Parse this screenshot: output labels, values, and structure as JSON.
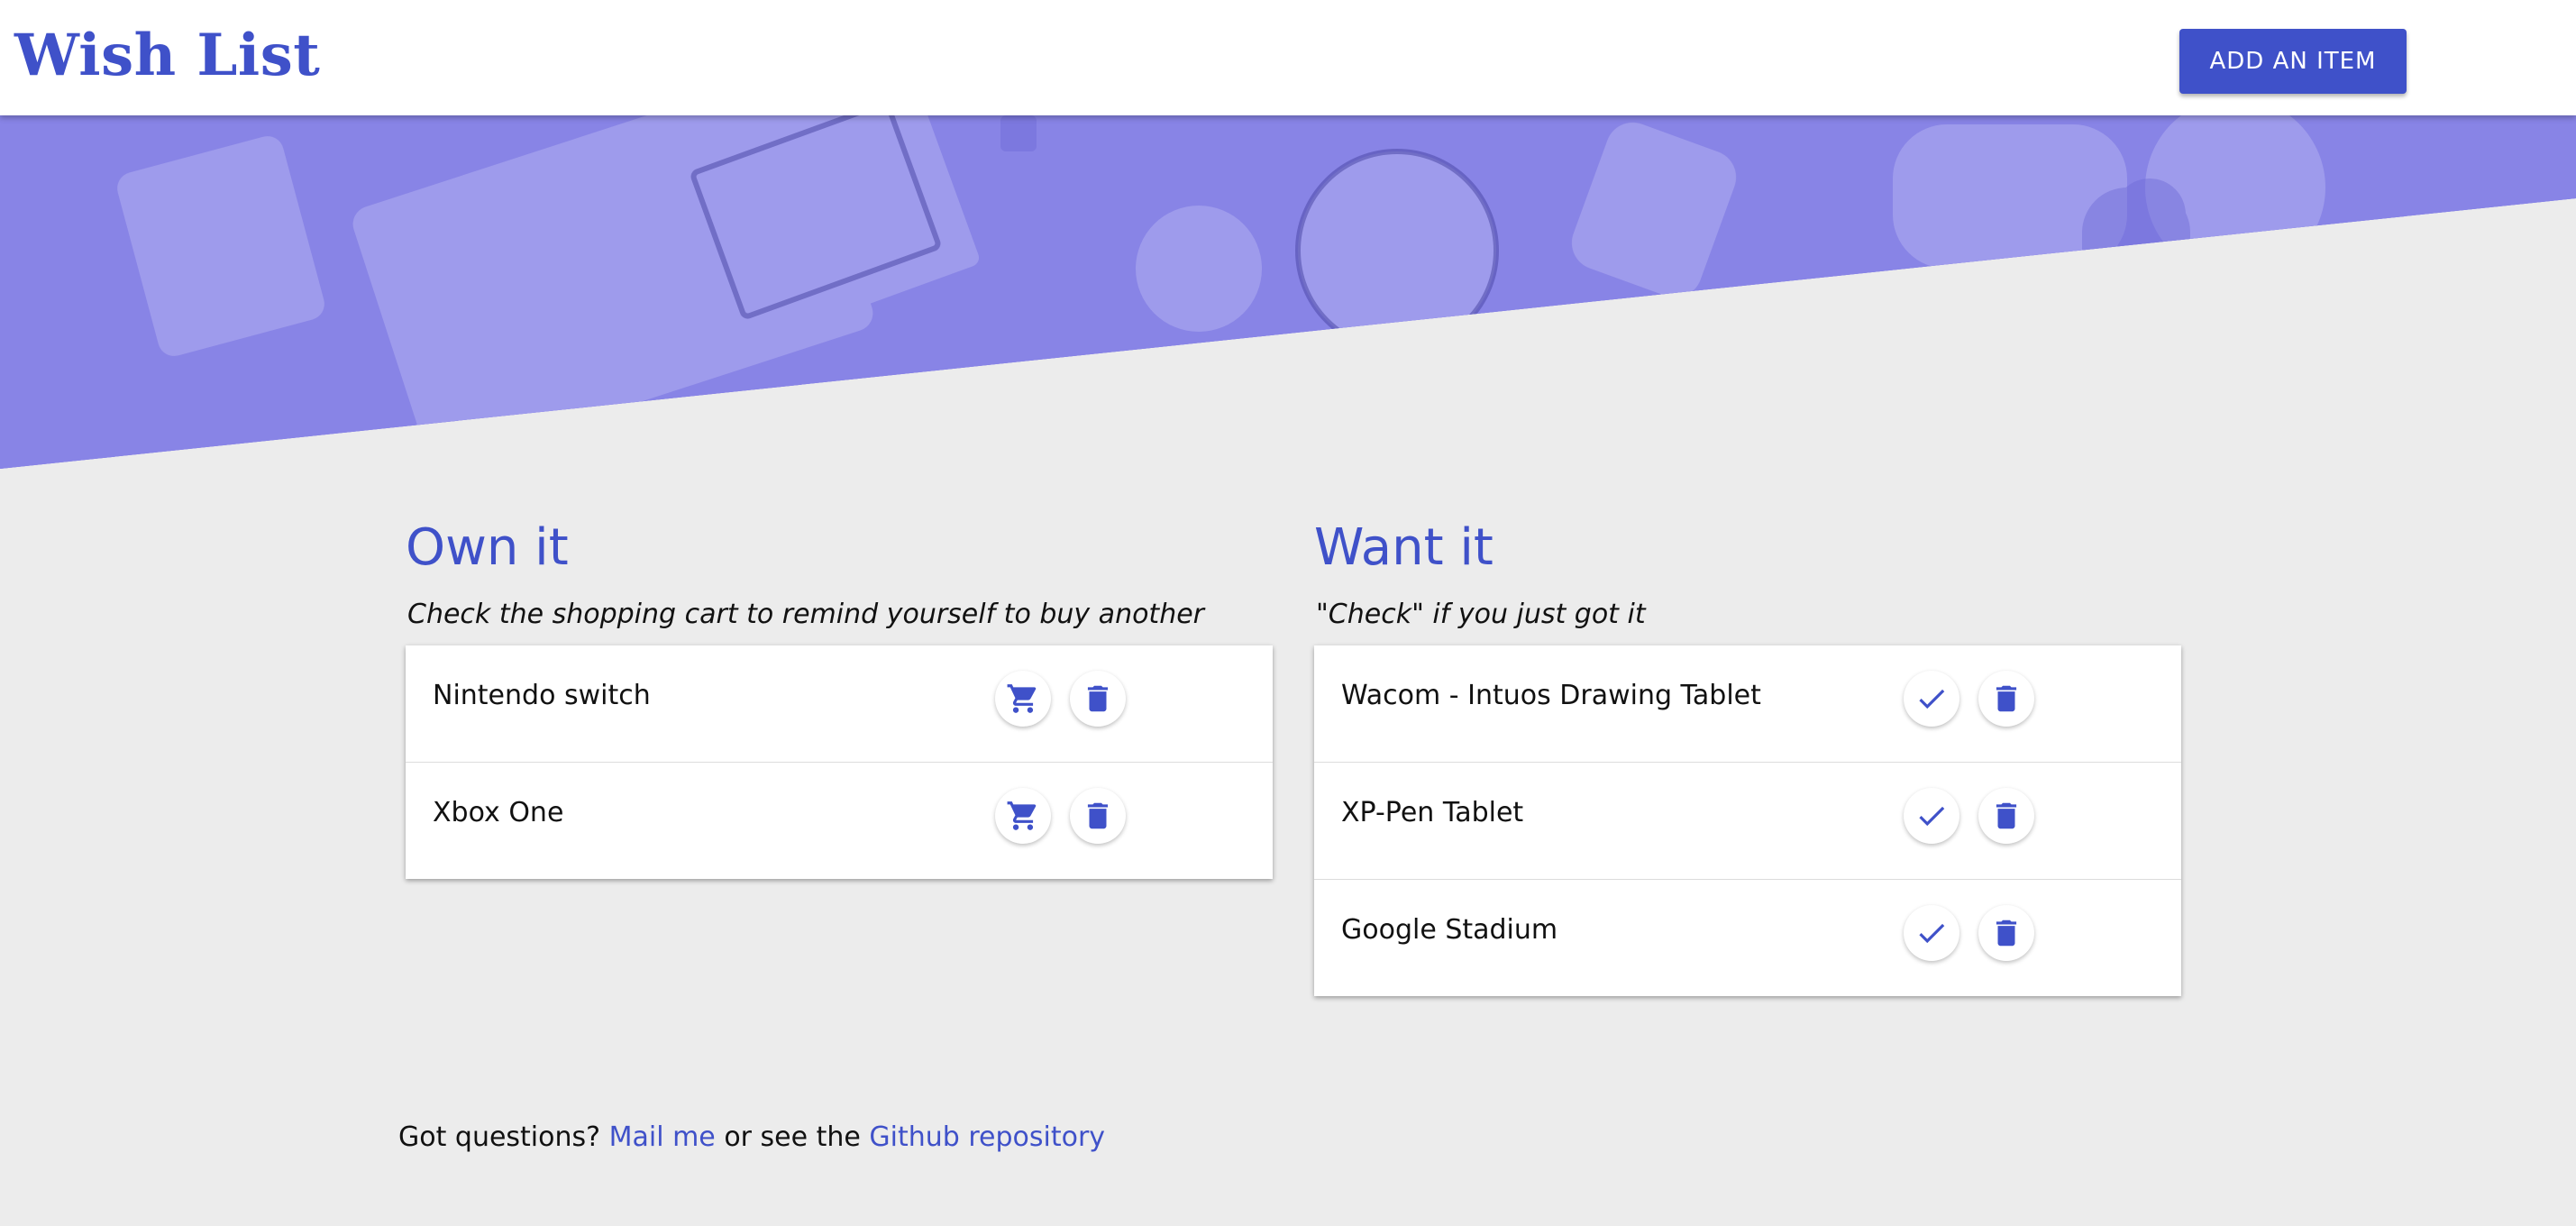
{
  "header": {
    "title": "Wish List",
    "add_button_label": "ADD AN ITEM"
  },
  "own": {
    "title": "Own it",
    "subtitle": "Check the shopping cart to remind yourself to buy another",
    "items": [
      {
        "label": "Nintendo switch"
      },
      {
        "label": "Xbox One"
      }
    ]
  },
  "want": {
    "title": "Want it",
    "subtitle": "\"Check\" if you just got it",
    "items": [
      {
        "label": "Wacom - Intuos Drawing Tablet"
      },
      {
        "label": "XP-Pen Tablet"
      },
      {
        "label": "Google Stadium"
      }
    ]
  },
  "footer": {
    "prefix": "Got questions?",
    "mail_link": "Mail me",
    "middle": "or see the",
    "repo_link": "Github repository"
  },
  "icons": {
    "cart": "shopping-cart-icon",
    "delete": "trash-icon",
    "check": "check-icon"
  },
  "colors": {
    "accent": "#3f51c9",
    "background": "#ececec",
    "hero_tint": "#8a86e8"
  }
}
